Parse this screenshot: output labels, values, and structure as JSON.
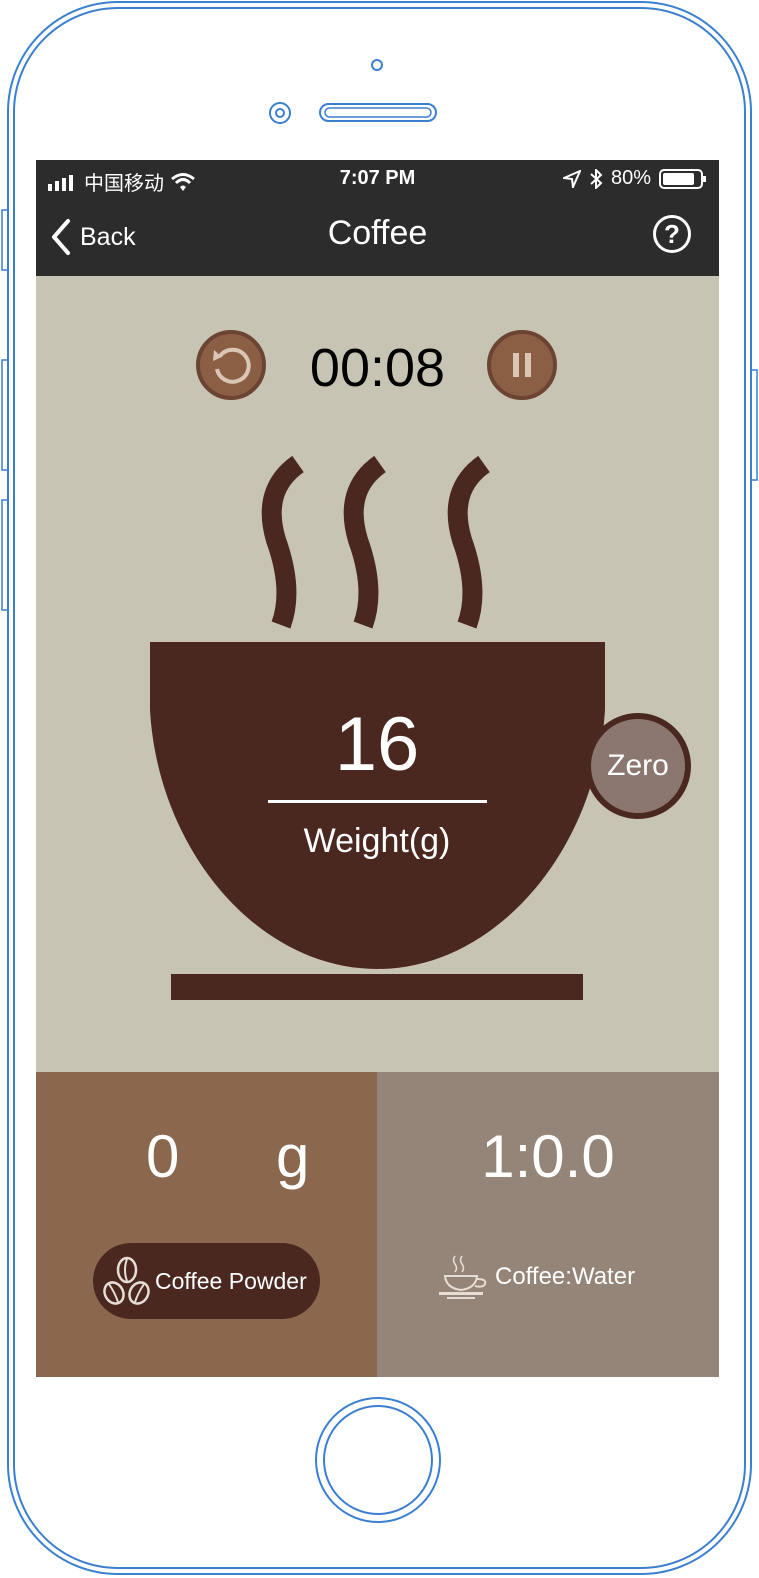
{
  "status": {
    "carrier": "中国移动",
    "time": "7:07 PM",
    "battery": "80%"
  },
  "nav": {
    "back_label": "Back",
    "title": "Coffee",
    "help_label": "?"
  },
  "timer": {
    "value": "00:08"
  },
  "weight": {
    "value": "16",
    "label": "Weight(g)",
    "zero_label": "Zero"
  },
  "powder": {
    "value": "0",
    "unit": "g",
    "label": "Coffee Powder"
  },
  "ratio": {
    "value": "1:0.0",
    "label": "Coffee:Water"
  },
  "colors": {
    "screen_bg": "#c8c4b3",
    "bar_bg": "#2c2c2c",
    "cup": "#4a2820",
    "button": "#8b5f44",
    "panel_left": "#8b674d",
    "panel_right": "#958478",
    "frame": "#3a7fd0"
  },
  "icons": [
    "wifi-icon",
    "location-icon",
    "bluetooth-icon",
    "battery-icon",
    "back-chevron-icon",
    "help-icon",
    "reset-icon",
    "pause-icon",
    "coffee-beans-icon",
    "coffee-cup-icon"
  ]
}
